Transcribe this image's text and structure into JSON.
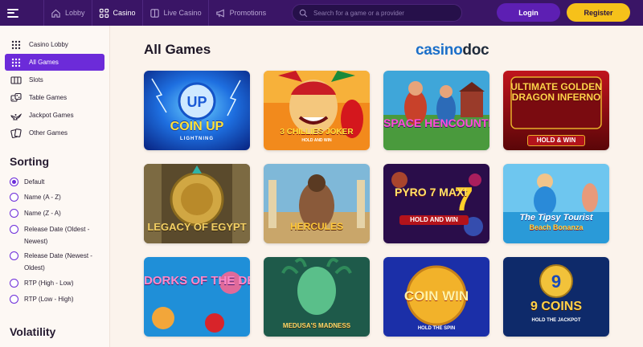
{
  "topbar": {
    "nav": [
      {
        "label": "Lobby",
        "icon": "home-icon"
      },
      {
        "label": "Casino",
        "icon": "grid-icon"
      },
      {
        "label": "Live Casino",
        "icon": "live-casino-icon"
      },
      {
        "label": "Promotions",
        "icon": "megaphone-icon"
      }
    ],
    "active_nav": "Casino",
    "search_placeholder": "Search for a game or a provider",
    "login_label": "Login",
    "register_label": "Register"
  },
  "sidebar": {
    "categories": [
      {
        "label": "Casino Lobby",
        "icon": "grid-icon"
      },
      {
        "label": "All Games",
        "icon": "grid-icon"
      },
      {
        "label": "Slots",
        "icon": "slot-reels-icon"
      },
      {
        "label": "Table Games",
        "icon": "dice-icon"
      },
      {
        "label": "Jackpot Games",
        "icon": "genie-lamp-icon"
      },
      {
        "label": "Other Games",
        "icon": "cards-icon"
      }
    ],
    "active_category": "All Games",
    "sorting_title": "Sorting",
    "sorting_options": [
      {
        "line1": "Default",
        "line2": ""
      },
      {
        "line1": "Name (A - Z)",
        "line2": ""
      },
      {
        "line1": "Name (Z - A)",
        "line2": ""
      },
      {
        "line1": "Release Date (Oldest -",
        "line2": "Newest)"
      },
      {
        "line1": "Release Date (Newest -",
        "line2": "Oldest)"
      },
      {
        "line1": "RTP (High - Low)",
        "line2": ""
      },
      {
        "line1": "RTP (Low - High)",
        "line2": ""
      }
    ],
    "selected_sort": "Default",
    "volatility_title": "Volatility"
  },
  "main": {
    "title": "All Games",
    "logo": {
      "part1": "casino",
      "part2": "doc"
    },
    "games": [
      {
        "name": "COIN UP",
        "sub": "LIGHTNING"
      },
      {
        "name": "3 CHILLIES JOKER",
        "sub": "HOLD AND WIN"
      },
      {
        "name": "SPACE HENCOUNTER",
        "sub": ""
      },
      {
        "name": "ULTIMATE GOLDEN DRAGON INFERNO",
        "sub": "HOLD & WIN"
      },
      {
        "name": "LEGACY OF EGYPT",
        "sub": ""
      },
      {
        "name": "HERCULES",
        "sub": ""
      },
      {
        "name": "PYRO 7 MAXI",
        "sub": "HOLD AND WIN"
      },
      {
        "name": "The Tipsy Tourist",
        "sub": "Beach Bonanza"
      },
      {
        "name": "DORKS OF THE DEEP",
        "sub": ""
      },
      {
        "name": "MEDUSA'S MADNESS",
        "sub": ""
      },
      {
        "name": "COIN WIN",
        "sub": "HOLD THE SPIN"
      },
      {
        "name": "9 COINS",
        "sub": "HOLD THE JACKPOT"
      }
    ]
  }
}
